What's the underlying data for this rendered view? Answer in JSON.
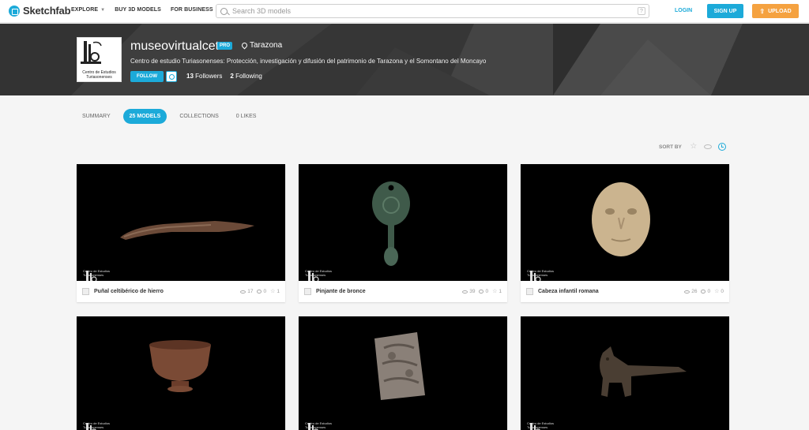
{
  "nav": {
    "logo": "Sketchfab",
    "explore": "EXPLORE",
    "buy": "BUY 3D MODELS",
    "business": "FOR BUSINESS",
    "search_placeholder": "Search 3D models",
    "help": "?",
    "login": "LOGIN",
    "signup": "SIGN UP",
    "upload": "UPLOAD"
  },
  "profile": {
    "username": "museovirtualcet",
    "badge": "PRO",
    "location": "Tarazona",
    "bio": "Centro de estudio Turiasonenses: Protección, investigación y difusión del patrimonio de Tarazona y el Somontano del Moncayo",
    "avatar_caption": "Centro de Estudios Turiasonenses",
    "follow": "FOLLOW",
    "followers_count": "13",
    "followers_label": "Followers",
    "following_count": "2",
    "following_label": "Following"
  },
  "tabs": {
    "summary": "SUMMARY",
    "models": "25 MODELS",
    "collections": "COLLECTIONS",
    "likes": "0 LIKES"
  },
  "sort": {
    "label": "SORT BY"
  },
  "watermark": "Centro de Estudios Turiasonenses",
  "models": [
    {
      "title": "Puñal celtibérico de hierro",
      "views": "17",
      "comments": "0",
      "likes": "1"
    },
    {
      "title": "Pinjante de bronce",
      "views": "39",
      "comments": "0",
      "likes": "1"
    },
    {
      "title": "Cabeza infantil romana",
      "views": "26",
      "comments": "0",
      "likes": "0"
    }
  ],
  "colors": {
    "accent": "#1caad9",
    "upload": "#f5a240",
    "banner": "#3a3a3a"
  }
}
